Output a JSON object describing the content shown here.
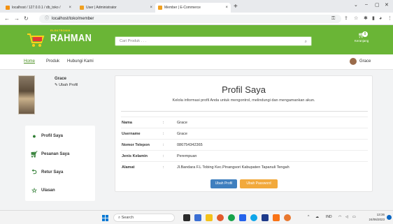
{
  "browser": {
    "tabs": [
      {
        "label": "localhost / 127.0.0.1 / db_toko /",
        "color": "#f29111"
      },
      {
        "label": "User | Administrator",
        "color": "#f0a020"
      },
      {
        "label": "Member | E-Commerce",
        "color": "#f0a020"
      }
    ],
    "new_tab": "+",
    "url": "localhost/toko/member"
  },
  "site": {
    "logo_sub": "ELEKTRONIK",
    "logo_brand": "RAHMAN",
    "search_placeholder": "Cari Produk . . .",
    "cart_count": "0",
    "cart_label": "Keranjang"
  },
  "nav": {
    "links": [
      "Home",
      "Produk",
      "Hubungi Kami"
    ],
    "user_name": "Grace"
  },
  "sidebar": {
    "profile_name": "Grace",
    "edit_profile": "Ubah Profil",
    "menu": [
      {
        "label": "Profil Saya",
        "icon": "user-icon"
      },
      {
        "label": "Pesanan Saya",
        "icon": "cart-icon"
      },
      {
        "label": "Retur Saya",
        "icon": "return-icon"
      },
      {
        "label": "Ulasan",
        "icon": "star-icon"
      }
    ]
  },
  "profile": {
    "title": "Profil Saya",
    "description": "Kelola informasi profil Anda untuk mengontrol, melindungi dan mengamankan akun.",
    "fields": [
      {
        "label": "Nama",
        "value": "Grace"
      },
      {
        "label": "Username",
        "value": "Grace"
      },
      {
        "label": "Nomor Telepon",
        "value": "086754342365"
      },
      {
        "label": "Jenis Kelamin",
        "value": "Perempuan"
      },
      {
        "label": "Alamat",
        "value": "Jl.Bandara F.L Tobing Kec.Pinangsori Kabupaten Tapanuli Tengah"
      }
    ],
    "separator": ":",
    "edit_button": "Ubah Profil",
    "password_button": "Ubah Password"
  },
  "taskbar": {
    "search_placeholder": "Search",
    "lang": "IND",
    "time": "13:36",
    "date": "24/06/2023"
  },
  "colors": {
    "brand_green": "#6ab536",
    "button_blue": "#3f7fbf",
    "button_orange": "#f2a93b"
  }
}
